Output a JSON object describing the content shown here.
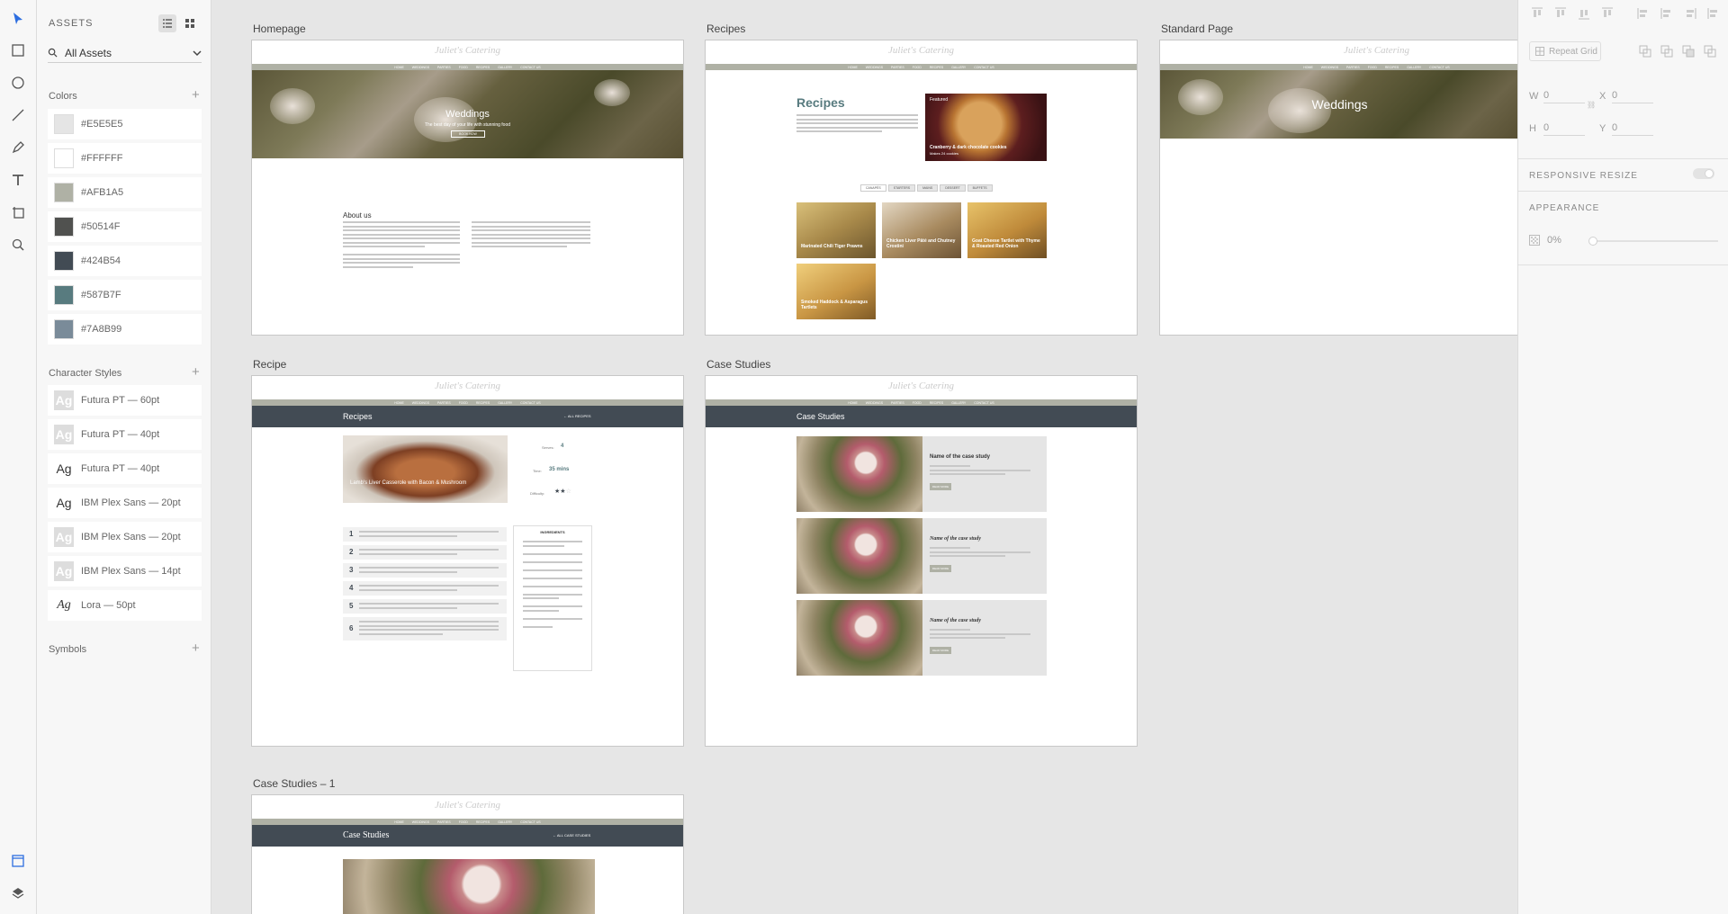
{
  "assets_panel": {
    "title": "ASSETS",
    "filter": "All Assets",
    "colors_heading": "Colors",
    "colors": [
      "#E5E5E5",
      "#FFFFFF",
      "#AFB1A5",
      "#50514F",
      "#424B54",
      "#587B7F",
      "#7A8B99"
    ],
    "char_heading": "Character Styles",
    "char_styles": [
      {
        "glyph": "Ag",
        "label": "Futura PT — 60pt"
      },
      {
        "glyph": "Ag",
        "label": "Futura PT — 40pt"
      },
      {
        "glyph": "Ag",
        "label": "Futura PT — 40pt"
      },
      {
        "glyph": "Ag",
        "label": "IBM Plex Sans — 20pt"
      },
      {
        "glyph": "Ag",
        "label": "IBM Plex Sans — 20pt"
      },
      {
        "glyph": "Ag",
        "label": "IBM Plex Sans — 14pt"
      },
      {
        "glyph": "Ag",
        "label": "Lora — 50pt"
      }
    ],
    "symbols_heading": "Symbols"
  },
  "artboards": {
    "homepage": {
      "label": "Homepage",
      "logo": "Juliet's Catering",
      "nav": [
        "HOME",
        "WEDDINGS",
        "PARTIES",
        "FOOD",
        "RECIPES",
        "GALLERY",
        "CONTACT US"
      ],
      "hero_title": "Weddings",
      "hero_sub": "The best day of your life with stunning food",
      "hero_button": "BOOK NOW",
      "about_title": "About us"
    },
    "recipes": {
      "label": "Recipes",
      "title": "Recipes",
      "featured_tag": "Featured",
      "featured_title": "Cranberry & dark chocolate cookies",
      "featured_meta": "Makes 24 cookies",
      "tabs": [
        "CANAPÉS",
        "STARTERS",
        "MAINS",
        "DESSERT",
        "BUFFETS"
      ],
      "cards": [
        "Marinated Chili Tiger Prawns",
        "Chicken Liver Pâté and Chutney Crostini",
        "Goat Cheese Tartlet with Thyme & Roasted Red Onion",
        "Smoked Haddock & Asparagus Tartlets"
      ]
    },
    "standard": {
      "label": "Standard Page",
      "hero_title": "Weddings"
    },
    "recipe": {
      "label": "Recipe",
      "bar_title": "Recipes",
      "back_link": "← ALL RECIPES",
      "image_title": "Lamb's Liver Casserole with Bacon & Mushroom",
      "serves_label": "Serves:",
      "serves_value": "4",
      "time_label": "Time:",
      "time_value": "35 mins",
      "difficulty_label": "Difficulty:",
      "steps": [
        "1",
        "2",
        "3",
        "4",
        "5",
        "6"
      ],
      "ingredients_head": "INGREDIENTS"
    },
    "case_studies": {
      "label": "Case Studies",
      "bar_title": "Case Studies",
      "items": [
        "Name of the case study",
        "Name of the case study",
        "Name of the case study"
      ],
      "button": "READ MORE"
    },
    "case_studies_1": {
      "label": "Case Studies – 1",
      "bar_title": "Case Studies",
      "back_link": "← ALL CASE STUDIES"
    }
  },
  "props_panel": {
    "repeat_grid": "Repeat Grid",
    "w_label": "W",
    "w_value": "0",
    "x_label": "X",
    "x_value": "0",
    "h_label": "H",
    "h_value": "0",
    "y_label": "Y",
    "y_value": "0",
    "responsive_resize": "RESPONSIVE RESIZE",
    "appearance": "APPEARANCE",
    "opacity": "0%"
  }
}
